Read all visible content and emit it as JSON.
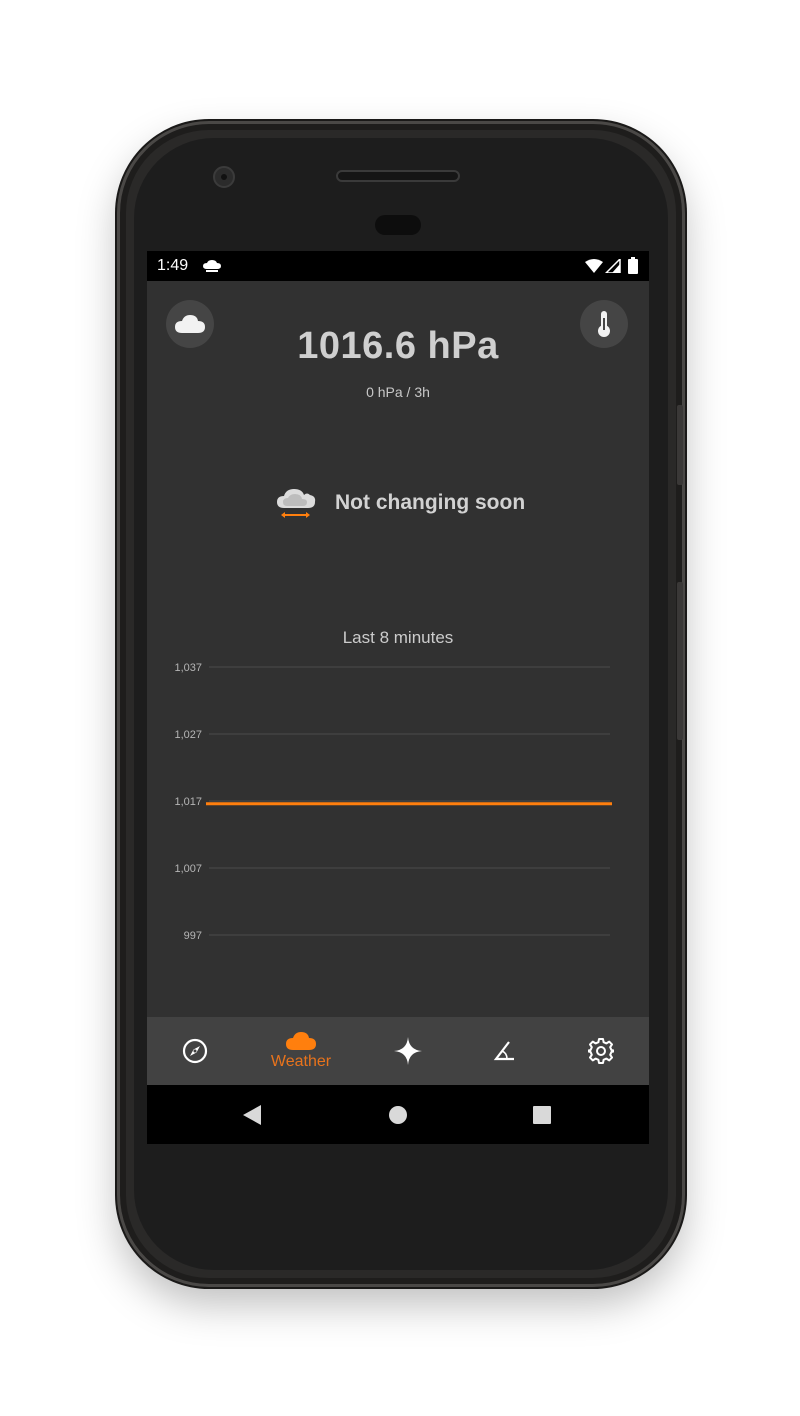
{
  "statusbar": {
    "time": "1:49"
  },
  "header": {
    "pressure": "1016.6 hPa",
    "change": "0 hPa / 3h"
  },
  "prediction": {
    "text": "Not changing soon"
  },
  "chart_title": "Last 8 minutes",
  "chart_data": {
    "type": "line",
    "title": "Last 8 minutes",
    "xlabel": "",
    "ylabel": "",
    "y_ticks": [
      "1,037",
      "1,027",
      "1,017",
      "1,007",
      "997"
    ],
    "y_tick_values": [
      1037,
      1027,
      1017,
      1007,
      997
    ],
    "ylim": [
      997,
      1037
    ],
    "grid": true,
    "series": [
      {
        "color": "#ff7f0e",
        "x": [
          0,
          8
        ],
        "values": [
          1016.6,
          1016.6
        ]
      }
    ]
  },
  "bottom_nav": {
    "items": [
      {
        "name": "compass",
        "label": ""
      },
      {
        "name": "weather",
        "label": "Weather"
      },
      {
        "name": "astronomy",
        "label": ""
      },
      {
        "name": "angle",
        "label": ""
      },
      {
        "name": "settings",
        "label": ""
      }
    ]
  },
  "colors": {
    "accent": "#ff7f0e",
    "background": "#313131",
    "nav_background": "#424242"
  }
}
